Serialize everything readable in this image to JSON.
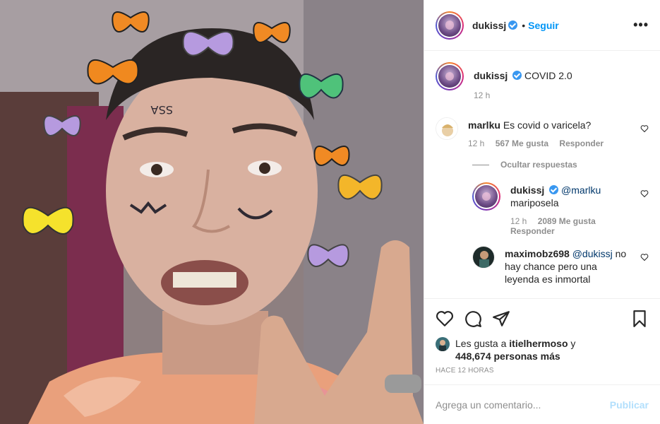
{
  "header": {
    "username": "dukissj",
    "separator": "•",
    "follow_label": "Seguir",
    "more_icon": "more-horizontal-icon",
    "more_text": "•••"
  },
  "caption": {
    "username": "dukissj",
    "text": "COVID 2.0",
    "time": "12 h"
  },
  "comments": [
    {
      "username": "marlku",
      "text": "Es covid o varicela?",
      "time": "12 h",
      "likes": "567 Me gusta",
      "reply_label": "Responder"
    }
  ],
  "hide_replies_label": "Ocultar respuestas",
  "replies": [
    {
      "username": "dukissj",
      "mention": "@marlku",
      "text": "mariposela",
      "time": "12 h",
      "likes": "2089 Me gusta",
      "reply_label": "Responder"
    },
    {
      "username": "maximobz698",
      "mention": "@dukissj",
      "text": "no hay chance pero una leyenda es inmortal"
    }
  ],
  "likes": {
    "prefix": "Les gusta a",
    "user": "itielhermoso",
    "conjunction": "y",
    "others": "448,674 personas más"
  },
  "ago": "HACE 12 HORAS",
  "add_comment": {
    "placeholder": "Agrega un comentario...",
    "publish_label": "Publicar"
  },
  "colors": {
    "accent": "#0095f6",
    "publish_disabled": "#b2dffc",
    "muted": "#8e8e8e",
    "verified": "#3897f0"
  }
}
